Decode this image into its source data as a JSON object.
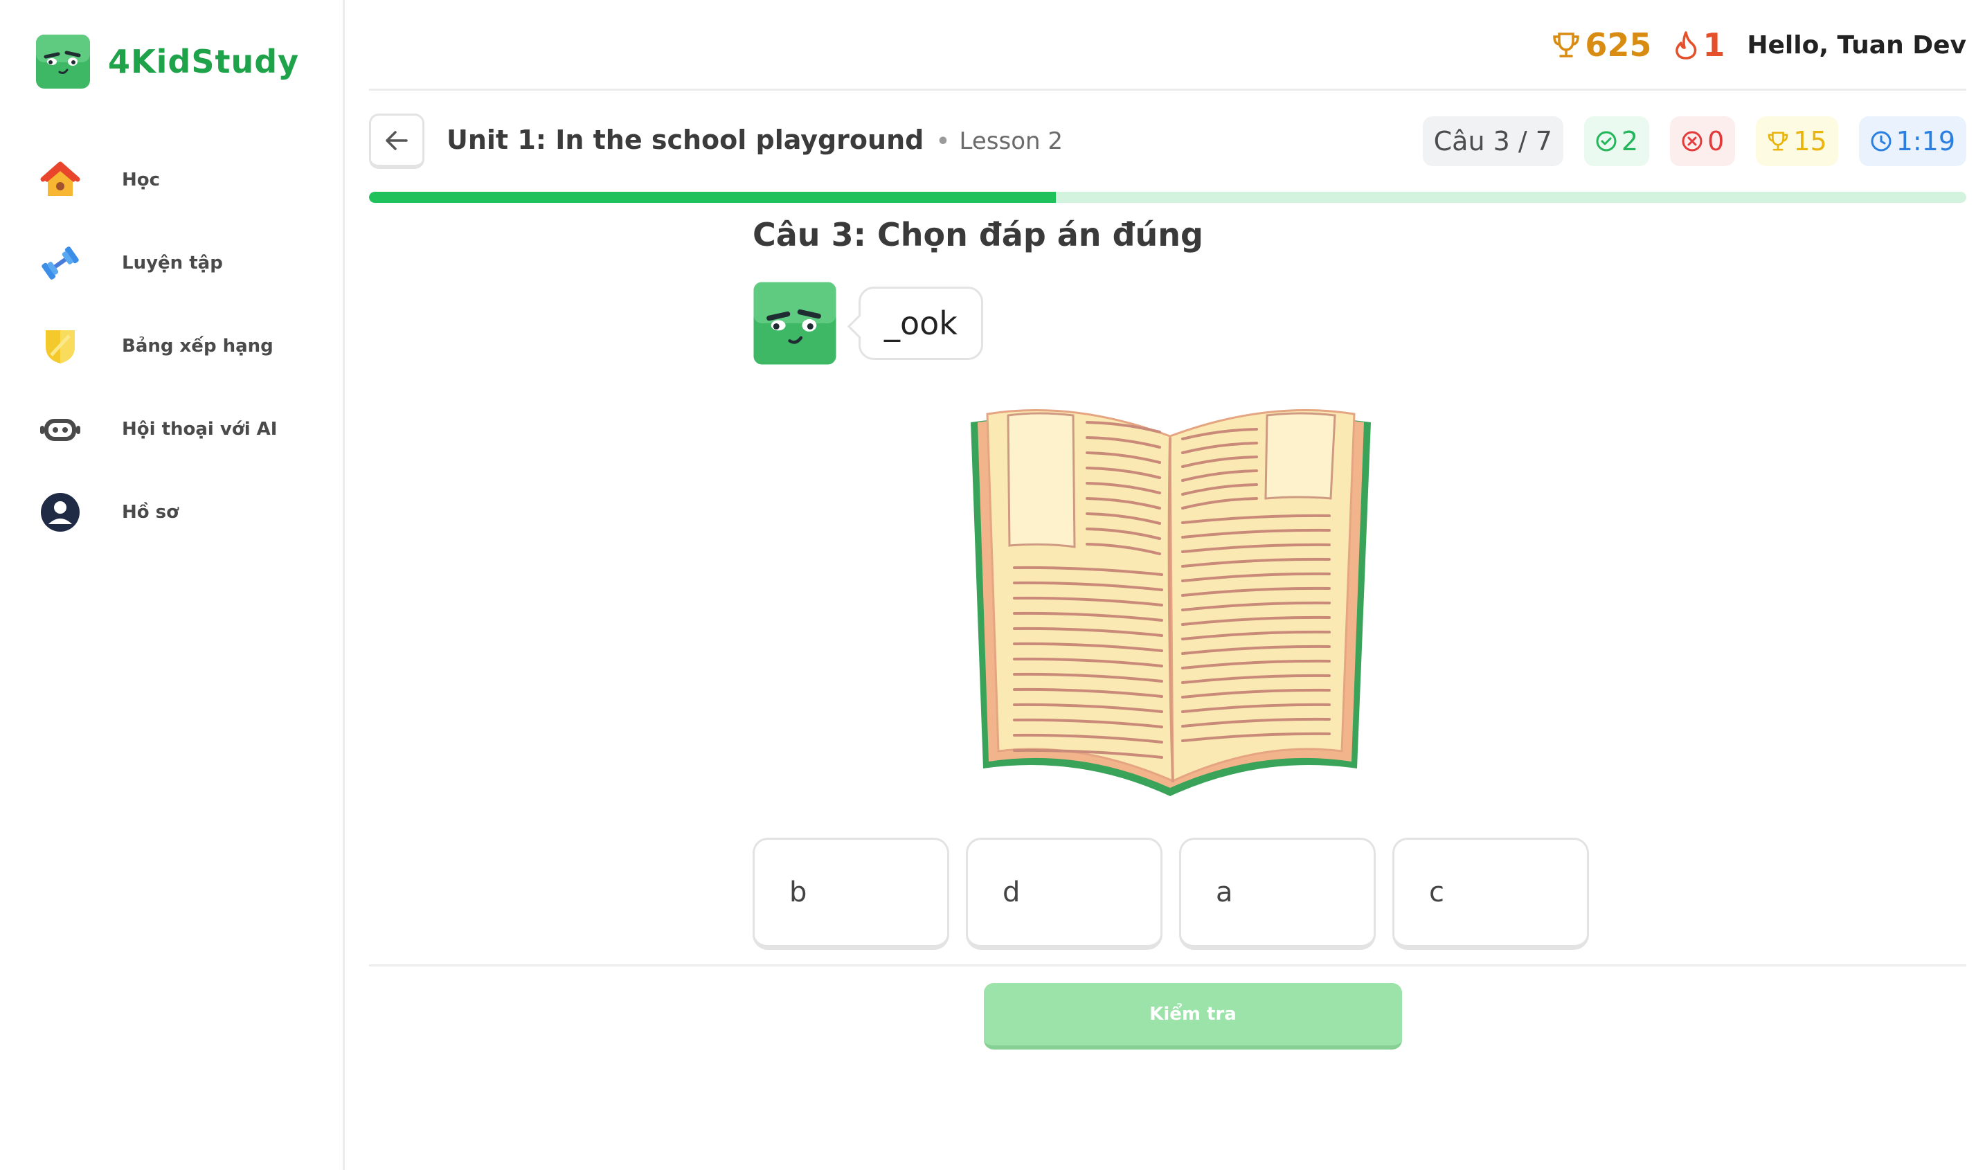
{
  "brand": {
    "name": "4KidStudy"
  },
  "sidebar": {
    "items": [
      {
        "label": "Học",
        "icon": "home-icon"
      },
      {
        "label": "Luyện tập",
        "icon": "dumbbell-icon"
      },
      {
        "label": "Bảng xếp hạng",
        "icon": "shield-icon"
      },
      {
        "label": "Hội thoại với AI",
        "icon": "robot-icon"
      },
      {
        "label": "Hồ sơ",
        "icon": "user-icon"
      }
    ]
  },
  "header": {
    "points": "625",
    "streak": "1",
    "greeting": "Hello, Tuan Dev"
  },
  "lesson": {
    "title": "Unit 1: In the school playground",
    "subtitle": "Lesson 2",
    "question_counter": "Câu 3 / 7",
    "correct": "2",
    "wrong": "0",
    "score": "15",
    "timer": "1:19",
    "progress": 0.43
  },
  "question": {
    "title": "Câu 3: Chọn đáp án đúng",
    "prompt": "_ook",
    "options": [
      "b",
      "d",
      "a",
      "c"
    ],
    "check_label": "Kiểm tra"
  },
  "colors": {
    "brand": "#1fa34a",
    "progress": "#1fc25a",
    "points": "#d98c12",
    "streak": "#e5502b"
  }
}
